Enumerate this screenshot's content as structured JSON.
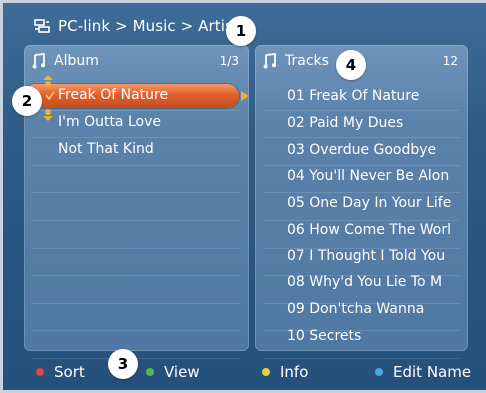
{
  "breadcrumb": "PC-link > Music > Artist",
  "album_panel": {
    "title": "Album",
    "count": "1/3",
    "items": [
      "Freak Of Nature",
      "I'm Outta Love",
      "Not That Kind"
    ]
  },
  "tracks_panel": {
    "title": "Tracks",
    "count": "12",
    "items": [
      "01 Freak Of Nature",
      "02 Paid My Dues",
      "03 Overdue Goodbye",
      "04 You'll Never Be Alon",
      "05 One Day In Your Life",
      "06 How Come The Worl",
      "07 I Thought I Told You",
      "08 Why'd You Lie To M",
      "09 Don'tcha Wanna",
      "10 Secrets"
    ]
  },
  "footer": {
    "sort": "Sort",
    "view": "View",
    "info": "Info",
    "edit_name": "Edit Name"
  },
  "callouts": [
    "1",
    "2",
    "3",
    "4"
  ],
  "colors": {
    "sort": "#e0434b",
    "view": "#56b84c",
    "info": "#e6d43f",
    "edit_name": "#4ba6e0",
    "highlight": "#e1602f"
  }
}
